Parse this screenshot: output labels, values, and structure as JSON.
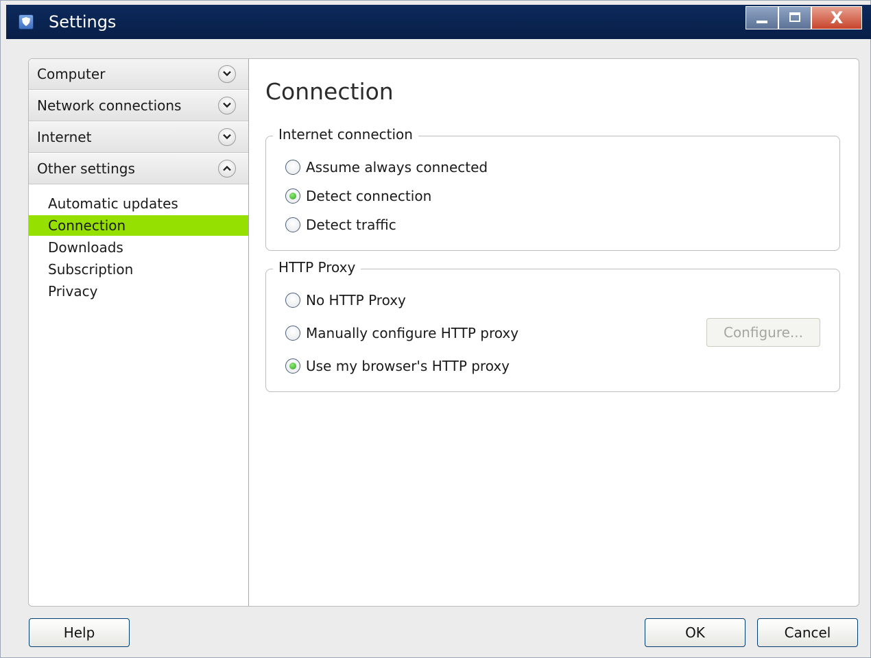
{
  "window": {
    "title": "Settings",
    "icon": "shield-app-icon",
    "controls": {
      "minimize": "minimize-icon",
      "maximize": "maximize-icon",
      "close": "X"
    }
  },
  "sidebar": {
    "categories": [
      {
        "label": "Computer",
        "state": "collapsed"
      },
      {
        "label": "Network connections",
        "state": "collapsed"
      },
      {
        "label": "Internet",
        "state": "collapsed"
      },
      {
        "label": "Other settings",
        "state": "expanded"
      }
    ],
    "subitems": [
      {
        "label": "Automatic updates",
        "selected": false
      },
      {
        "label": "Connection",
        "selected": true
      },
      {
        "label": "Downloads",
        "selected": false
      },
      {
        "label": "Subscription",
        "selected": false
      },
      {
        "label": "Privacy",
        "selected": false
      }
    ],
    "selection_color": "#96e000"
  },
  "main": {
    "title": "Connection",
    "internet_connection": {
      "legend": "Internet connection",
      "options": [
        {
          "label": "Assume always connected",
          "checked": false
        },
        {
          "label": "Detect connection",
          "checked": true
        },
        {
          "label": "Detect traffic",
          "checked": false
        }
      ]
    },
    "http_proxy": {
      "legend": "HTTP Proxy",
      "options": [
        {
          "label": "No HTTP Proxy",
          "checked": false
        },
        {
          "label": "Manually configure HTTP proxy",
          "checked": false
        },
        {
          "label": "Use my browser's HTTP proxy",
          "checked": true
        }
      ],
      "configure_label": "Configure...",
      "configure_enabled": false
    }
  },
  "footer": {
    "help_label": "Help",
    "ok_label": "OK",
    "cancel_label": "Cancel"
  }
}
